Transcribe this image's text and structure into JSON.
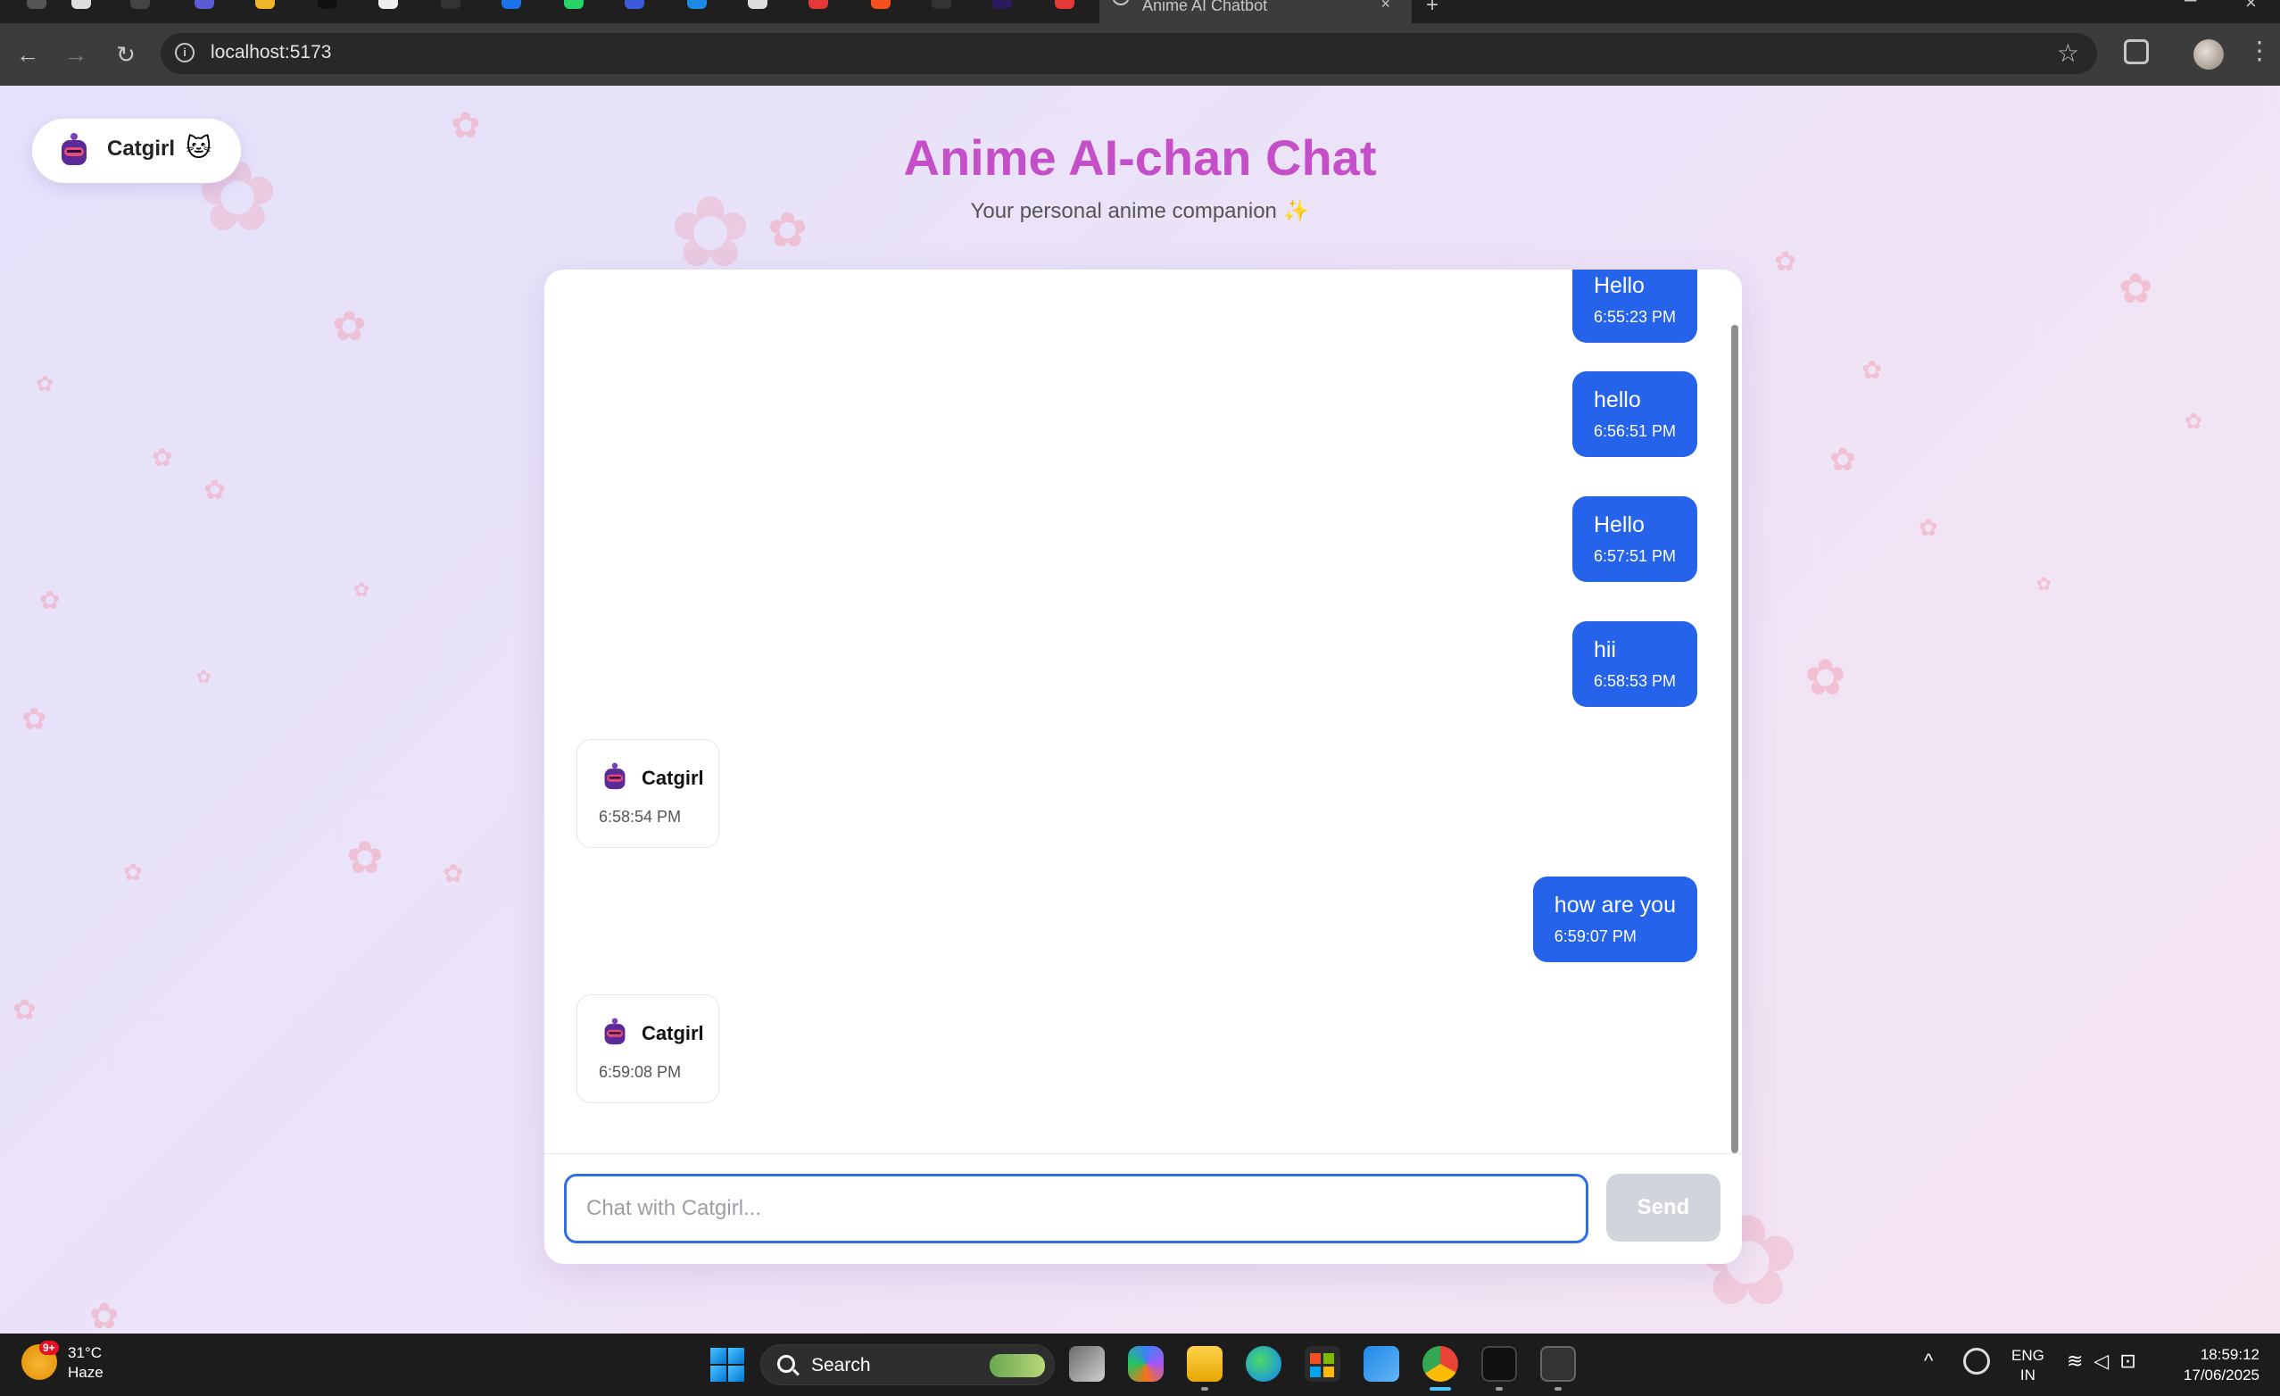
{
  "browser": {
    "active_tab_title": "Anime AI Chatbot",
    "url": "localhost:5173"
  },
  "page": {
    "character_pill": {
      "name": "Catgirl",
      "emoji": "🐱"
    },
    "title": "Anime AI-chan Chat",
    "subtitle": "Your personal anime companion ✨",
    "colors": {
      "accent": "#c44fc8",
      "user_bubble": "#2563eb",
      "input_border": "#2f6fe6"
    }
  },
  "messages": [
    {
      "role": "user",
      "text": "Hello",
      "time": "6:55:23 PM"
    },
    {
      "role": "user",
      "text": "hello",
      "time": "6:56:51 PM"
    },
    {
      "role": "user",
      "text": "Hello",
      "time": "6:57:51 PM"
    },
    {
      "role": "user",
      "text": "hii",
      "time": "6:58:53 PM"
    },
    {
      "role": "bot",
      "name": "Catgirl",
      "time": "6:58:54 PM"
    },
    {
      "role": "user",
      "text": "how are you",
      "time": "6:59:07 PM"
    },
    {
      "role": "bot",
      "name": "Catgirl",
      "time": "6:59:08 PM"
    }
  ],
  "composer": {
    "placeholder": "Chat with Catgirl...",
    "value": "",
    "send_label": "Send"
  },
  "taskbar": {
    "weather_badge": "9+",
    "temperature": "31°C",
    "condition": "Haze",
    "search_label": "Search",
    "lang_line1": "ENG",
    "lang_line2": "IN",
    "time": "18:59:12",
    "date": "17/06/2025"
  }
}
